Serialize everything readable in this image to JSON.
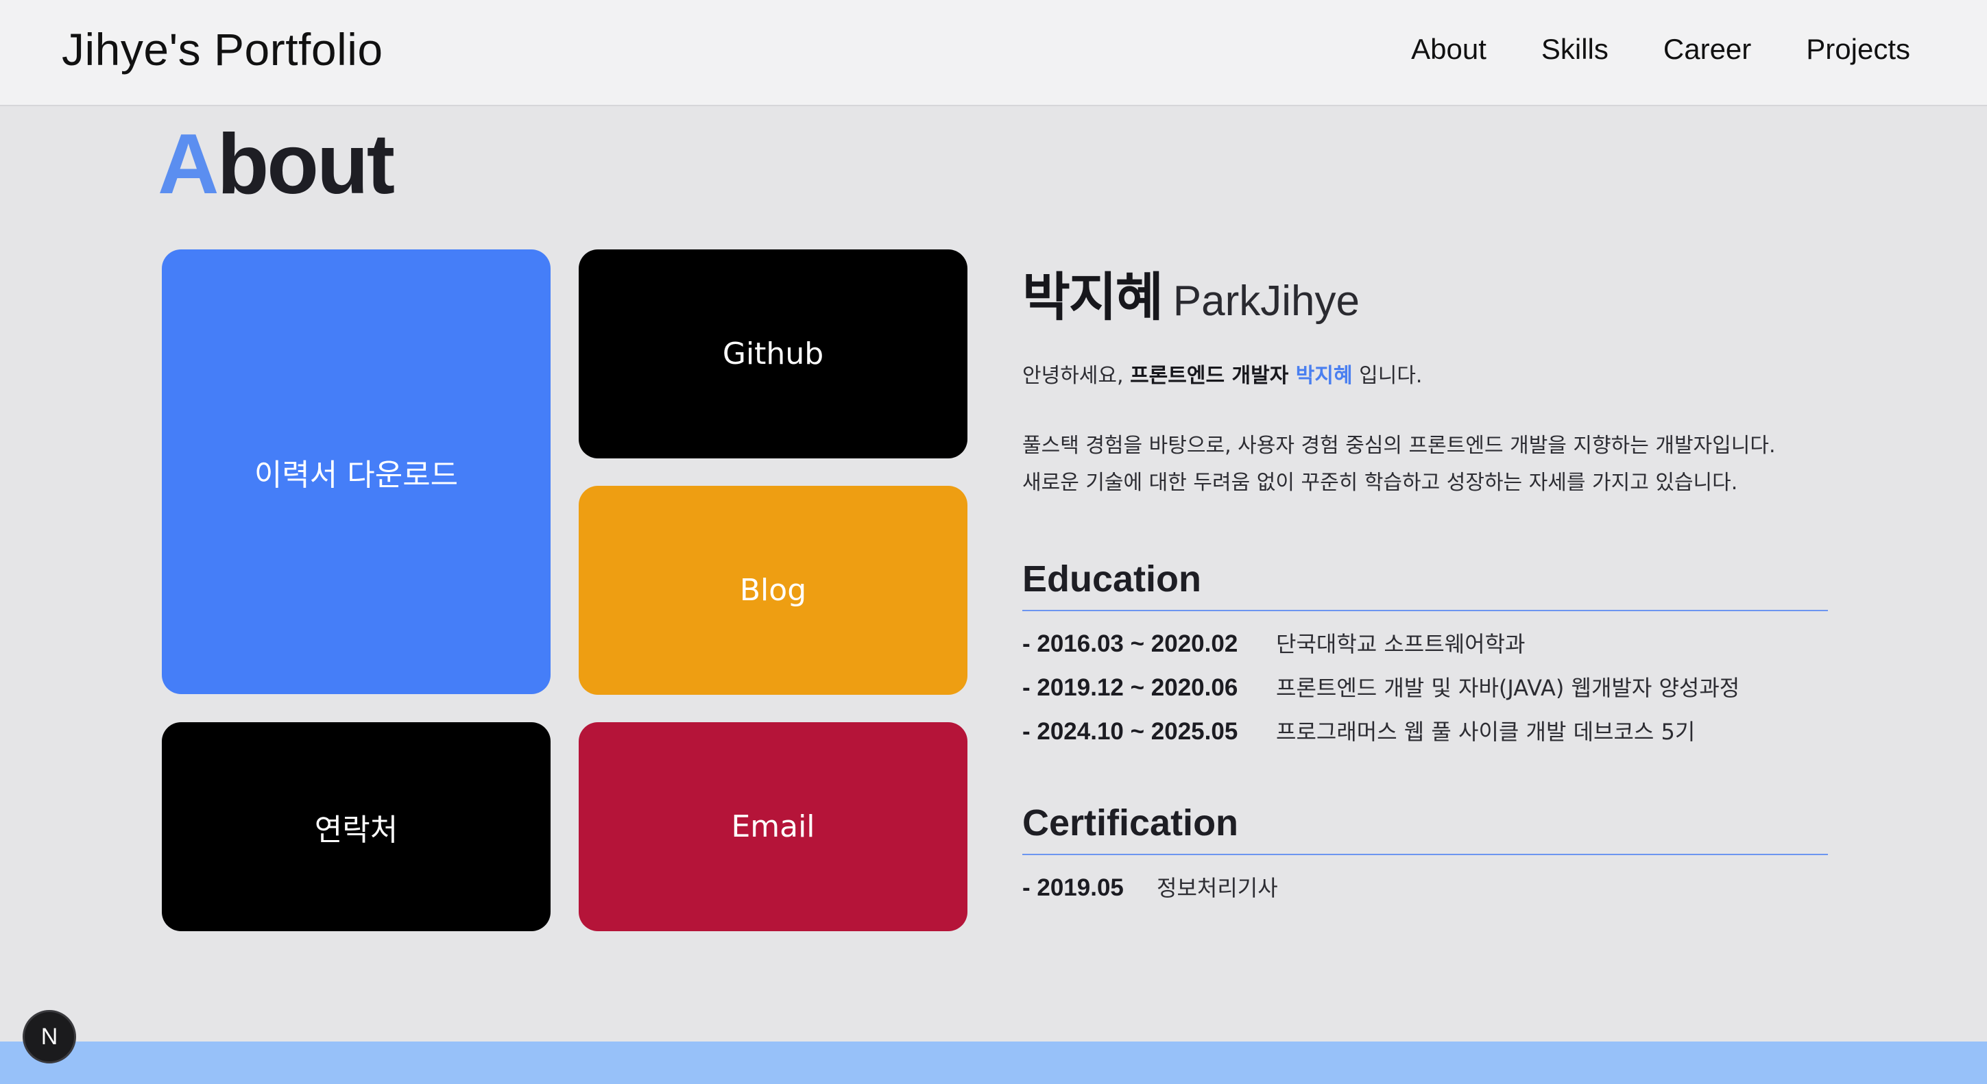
{
  "header": {
    "logo": "Jihye's Portfolio",
    "nav": [
      "About",
      "Skills",
      "Career",
      "Projects"
    ]
  },
  "about": {
    "title_first": "A",
    "title_rest": "bout",
    "cards": {
      "resume": {
        "label": "이력서 다운로드",
        "color": "#457ef8"
      },
      "github": {
        "label": "Github",
        "color": "#000000"
      },
      "blog": {
        "label": "Blog",
        "color": "#ee9e12"
      },
      "contact": {
        "label": "연락처",
        "color": "#000000"
      },
      "email": {
        "label": "Email",
        "color": "#b51439"
      }
    },
    "name_ko": "박지혜",
    "name_en": "ParkJihye",
    "intro": {
      "prefix": "안녕하세요, ",
      "role": "프론트엔드 개발자 ",
      "name": "박지혜",
      "suffix": " 입니다."
    },
    "desc_line1": "풀스택 경험을 바탕으로, 사용자 경험 중심의 프론트엔드 개발을 지향하는 개발자입니다.",
    "desc_line2": "새로운 기술에 대한 두려움 없이 꾸준히 학습하고 성장하는 자세를 가지고 있습니다.",
    "education": {
      "heading": "Education",
      "items": [
        {
          "date": "- 2016.03 ~ 2020.02",
          "text": "단국대학교 소프트웨어학과"
        },
        {
          "date": "- 2019.12 ~ 2020.06",
          "text": "프론트엔드 개발 및 자바(JAVA) 웹개발자 양성과정"
        },
        {
          "date": "- 2024.10 ~ 2025.05",
          "text": "프로그래머스 웹 풀 사이클 개발 데브코스 5기"
        }
      ]
    },
    "certification": {
      "heading": "Certification",
      "items": [
        {
          "date": "- 2019.05",
          "text": "정보처리기사"
        }
      ]
    }
  },
  "badge": "N",
  "colors": {
    "accent": "#5b8ef0",
    "bottom_strip": "#97c1f9"
  }
}
